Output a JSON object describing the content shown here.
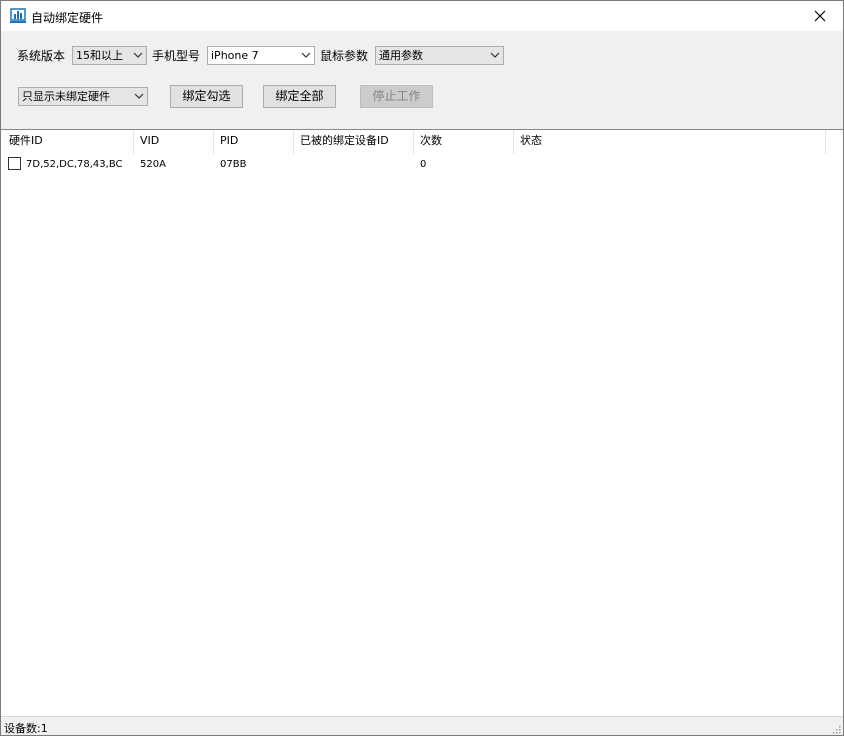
{
  "window": {
    "title": "自动绑定硬件"
  },
  "toolbar": {
    "system_version_label": "系统版本",
    "system_version_value": "15和以上",
    "phone_model_label": "手机型号",
    "phone_model_value": "iPhone 7",
    "mouse_params_label": "鼠标参数",
    "mouse_params_value": "通用参数",
    "filter_value": "只显示未绑定硬件",
    "bind_checked_label": "绑定勾选",
    "bind_all_label": "绑定全部",
    "stop_label": "停止工作"
  },
  "table": {
    "columns": [
      "硬件ID",
      "VID",
      "PID",
      "已被的绑定设备ID",
      "次数",
      "状态"
    ],
    "rows": [
      {
        "checked": false,
        "hardware_id": "7D,52,DC,78,43,BC",
        "vid": "520A",
        "pid": "07BB",
        "bound_device_id": "",
        "count": "0",
        "status": ""
      }
    ]
  },
  "status": {
    "device_count": "设备数:1"
  }
}
